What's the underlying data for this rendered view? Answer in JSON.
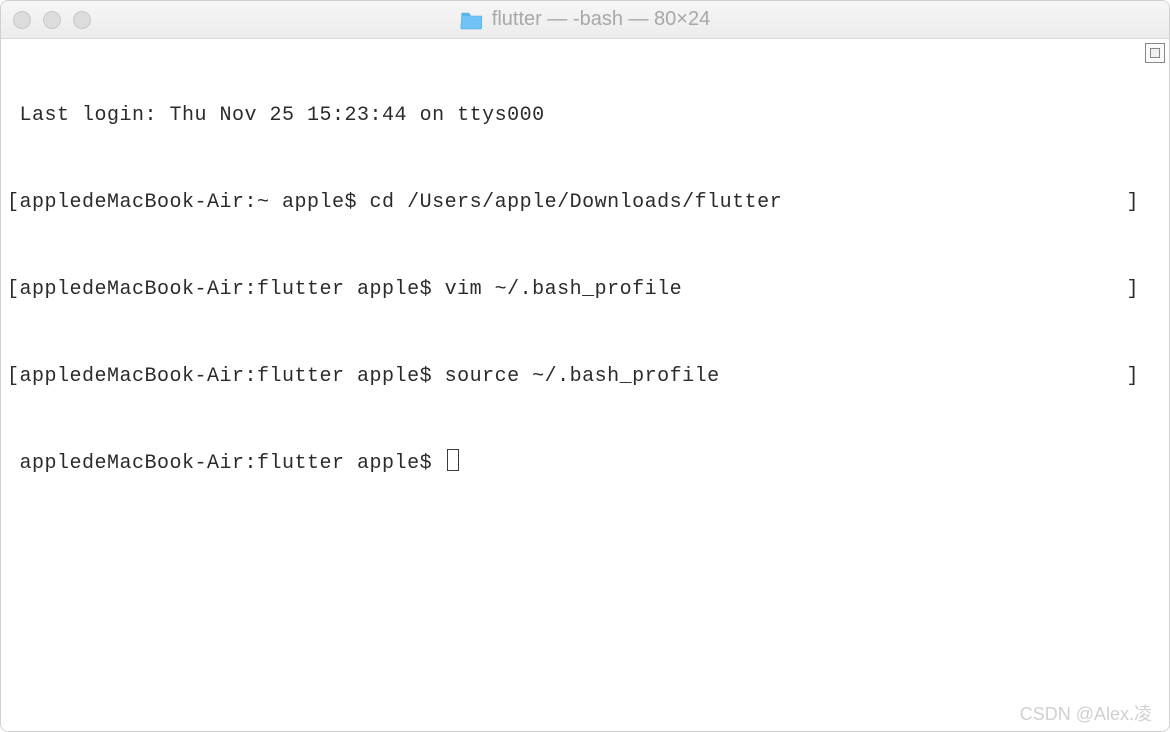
{
  "window": {
    "title": "flutter — -bash — 80×24"
  },
  "terminal": {
    "lines": [
      {
        "left": " Last login: Thu Nov 25 15:23:44 on ttys000",
        "right": ""
      },
      {
        "left": "[appledeMacBook-Air:~ apple$ cd /Users/apple/Downloads/flutter",
        "right": "]"
      },
      {
        "left": "[appledeMacBook-Air:flutter apple$ vim ~/.bash_profile",
        "right": "]"
      },
      {
        "left": "[appledeMacBook-Air:flutter apple$ source ~/.bash_profile",
        "right": "]"
      }
    ],
    "prompt": " appledeMacBook-Air:flutter apple$ "
  },
  "watermark": "CSDN @Alex.凌"
}
